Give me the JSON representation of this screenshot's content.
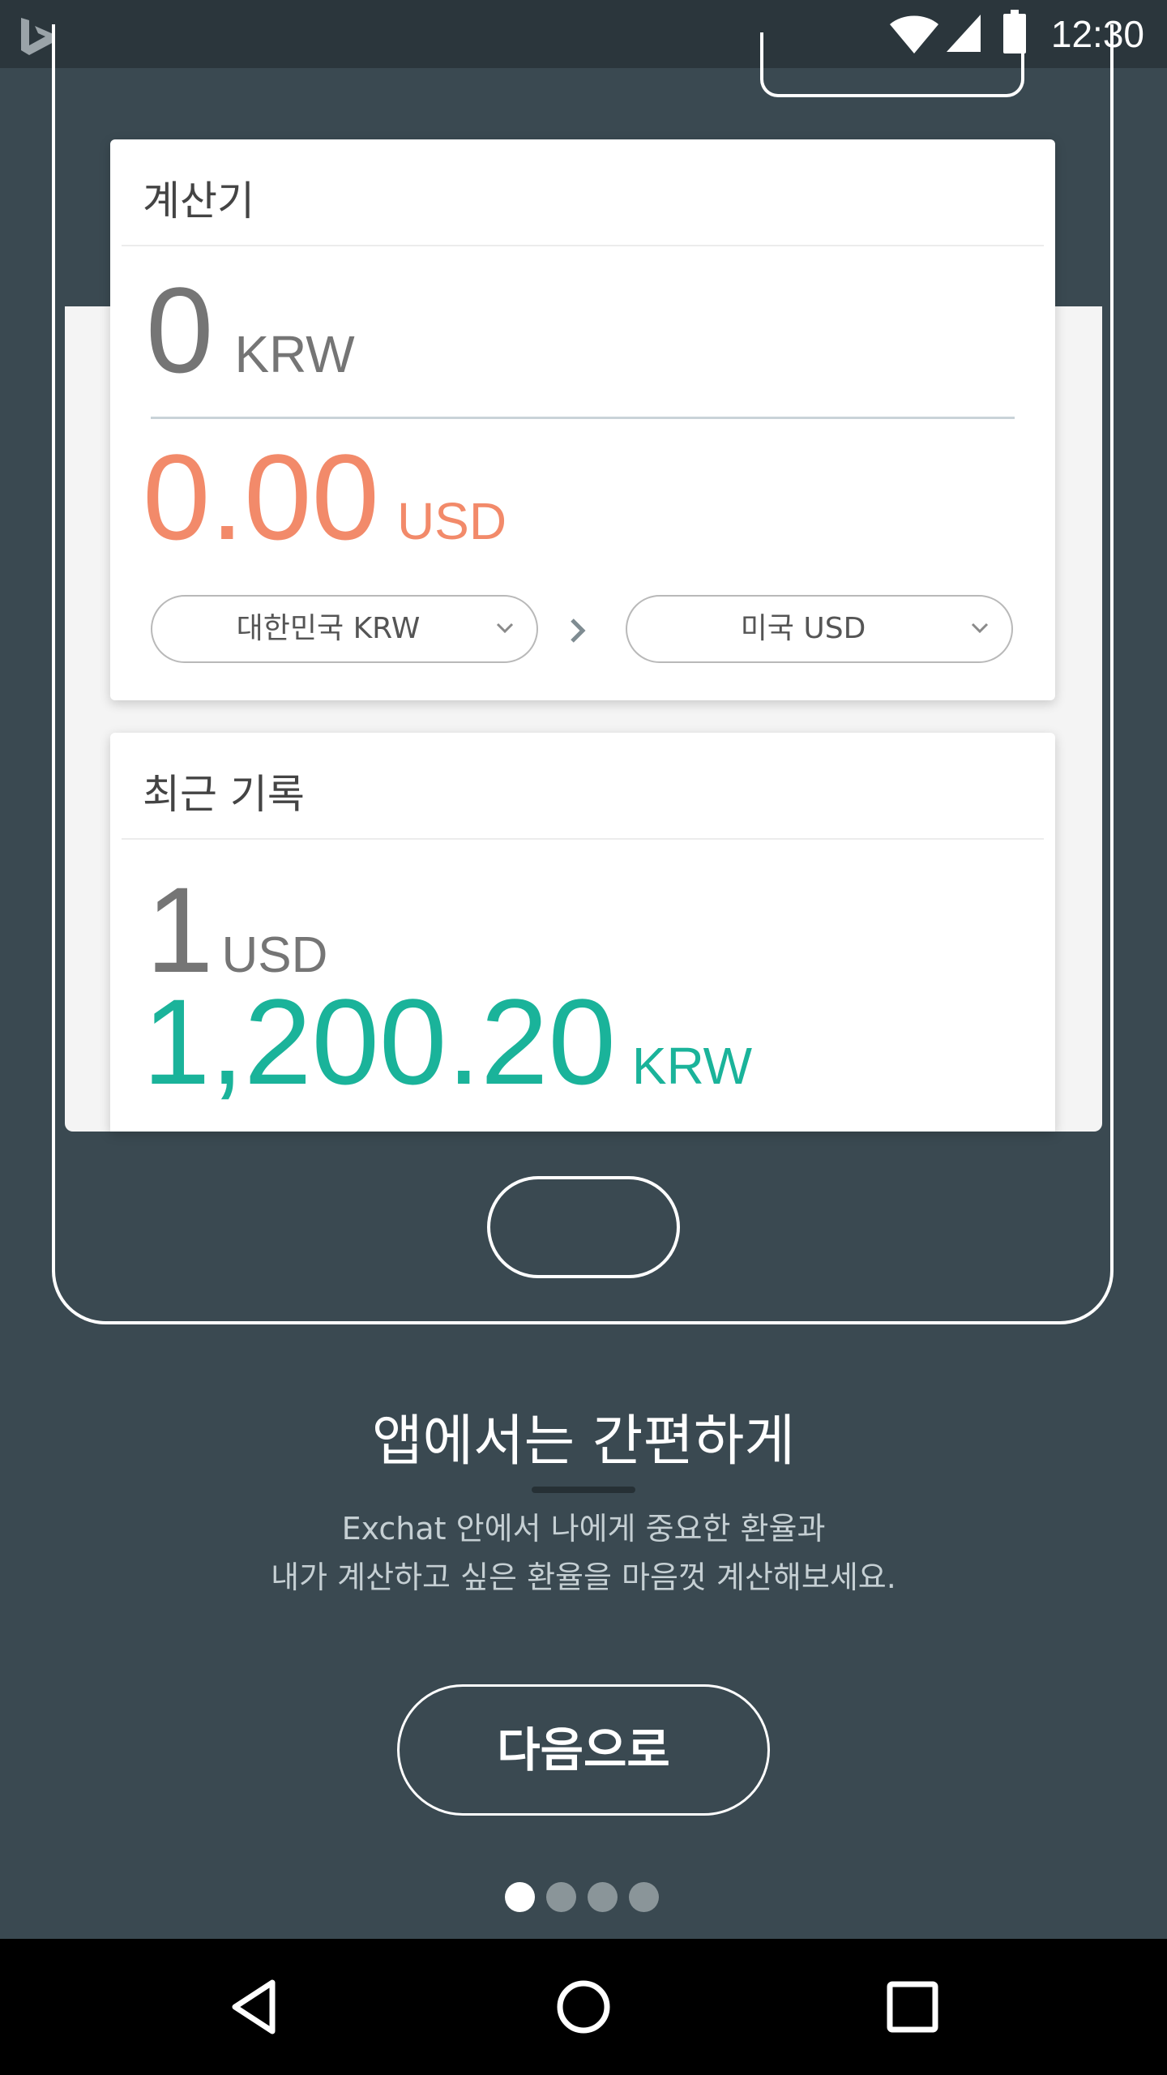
{
  "status_bar": {
    "time": "12:30",
    "icons": [
      "bing-logo-icon",
      "wifi-icon",
      "cell-signal-icon",
      "battery-icon"
    ]
  },
  "calculator": {
    "title": "계산기",
    "input_amount": "0",
    "input_currency": "KRW",
    "output_amount": "0.00",
    "output_currency": "USD",
    "from_select": "대한민국 KRW",
    "to_select": "미국 USD"
  },
  "recent": {
    "title": "최근 기록",
    "base_amount": "1",
    "base_currency": "USD",
    "quote_amount": "1,200.20",
    "quote_currency": "KRW"
  },
  "onboarding": {
    "headline": "앱에서는 간편하게",
    "description_lines": [
      "Exchat 안에서 나에게 중요한 환율과",
      "내가 계산하고 싶은 환율을 마음껏 계산해보세요."
    ],
    "next_label": "다음으로",
    "page_count": 4,
    "current_page": 1
  },
  "nav_bar": {
    "icons": [
      "back-triangle-icon",
      "home-circle-icon",
      "recents-square-icon"
    ]
  },
  "colors": {
    "background": "#3a4951",
    "status_bar": "#2b363c",
    "output_orange": "#f28a6a",
    "rate_green": "#1ab39a",
    "card": "#ffffff"
  }
}
